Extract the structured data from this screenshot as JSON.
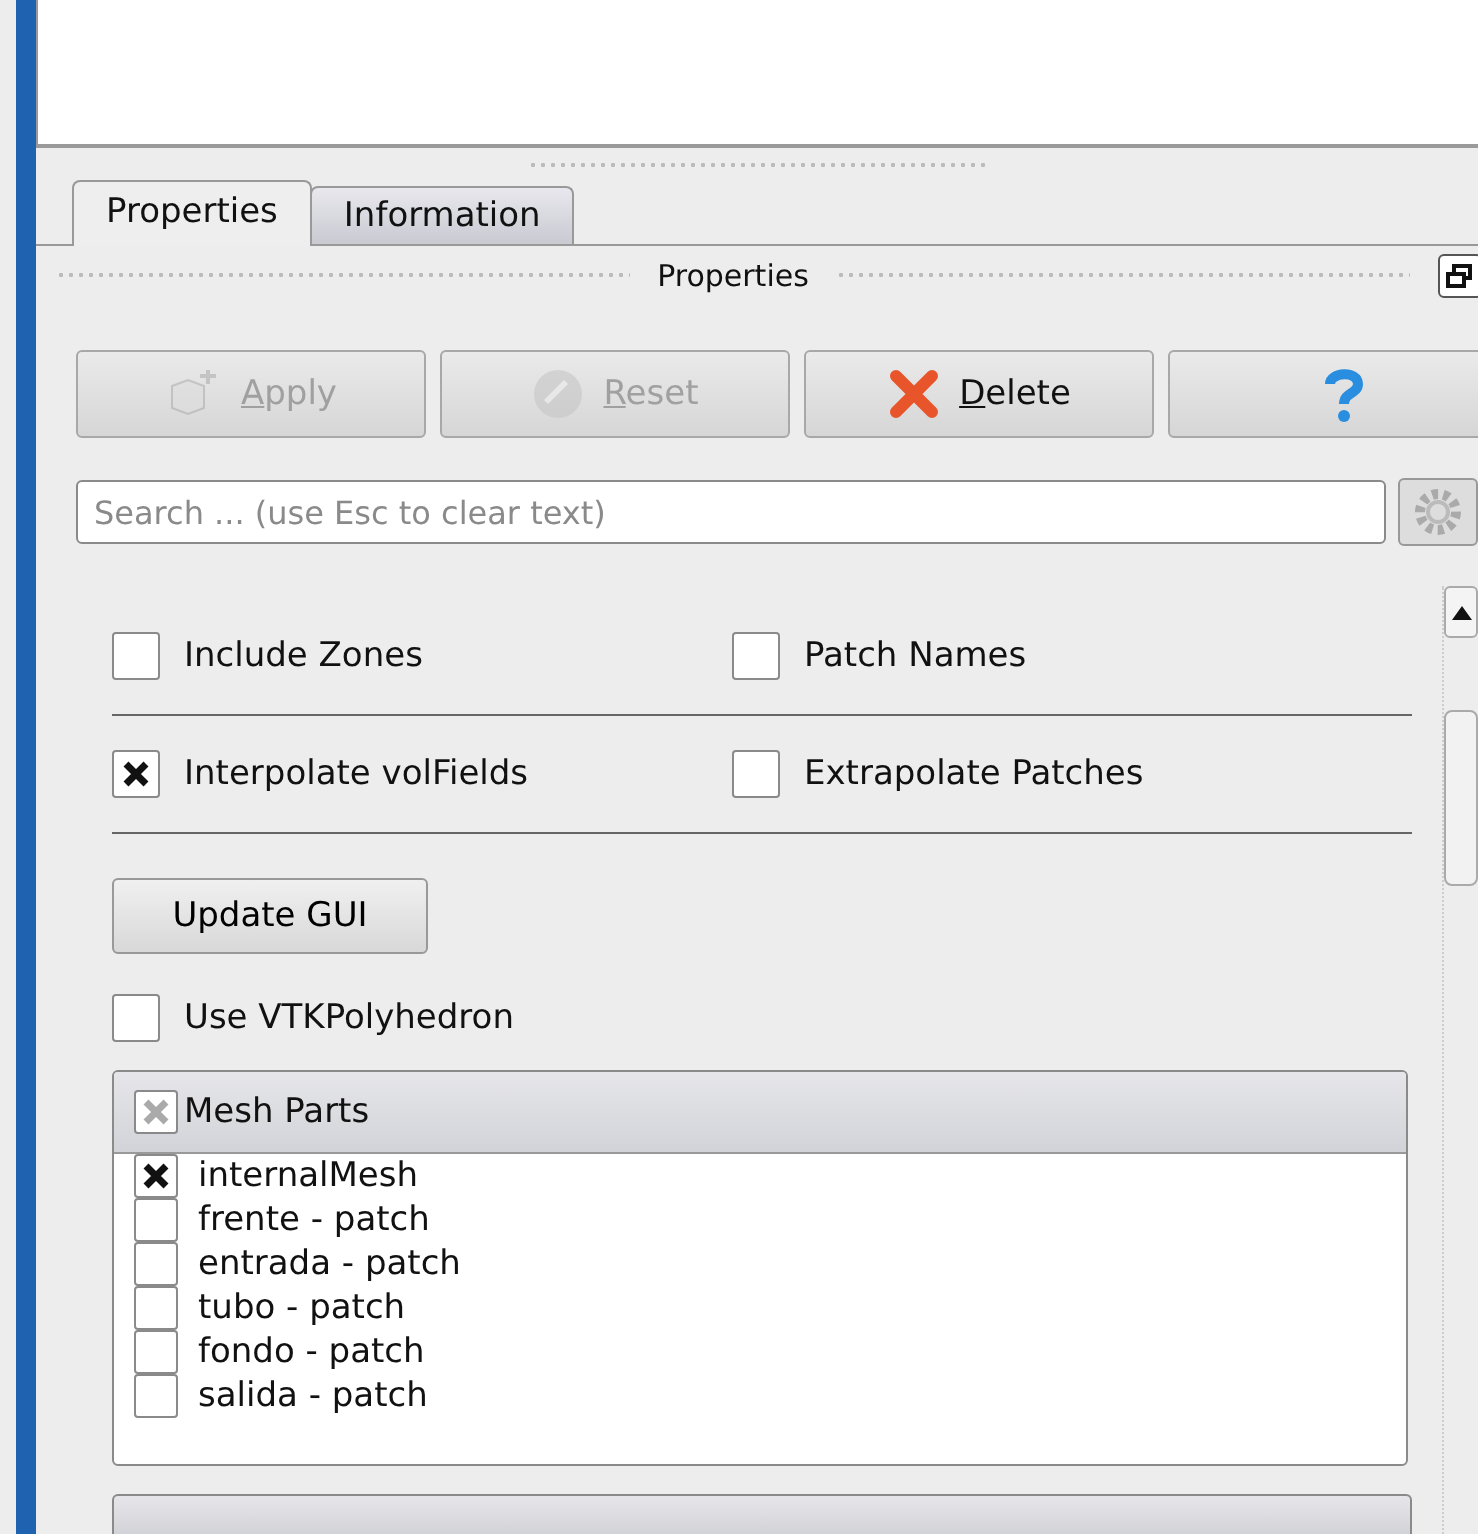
{
  "tabs": [
    {
      "label": "Properties",
      "selected": true
    },
    {
      "label": "Information",
      "selected": false
    }
  ],
  "panel_title": "Properties",
  "buttons": [
    {
      "kind": "apply",
      "label": "Apply",
      "disabled": true
    },
    {
      "kind": "reset",
      "label": "Reset",
      "disabled": true
    },
    {
      "kind": "delete",
      "label": "Delete",
      "disabled": false
    },
    {
      "kind": "help",
      "disabled": false
    }
  ],
  "search": {
    "placeholder": "Search ... (use Esc to clear text)"
  },
  "option_rows": [
    [
      {
        "label": "Include Zones",
        "checked": false
      },
      {
        "label": "Patch Names",
        "checked": false
      }
    ],
    [
      {
        "label": "Interpolate volFields",
        "checked": true
      },
      {
        "label": "Extrapolate Patches",
        "checked": false
      }
    ]
  ],
  "update_button": "Update GUI",
  "polyhedron": {
    "label": "Use VTKPolyhedron",
    "checked": false
  },
  "mesh_parts": {
    "header": "Mesh Parts",
    "select_all": {
      "partial": true
    },
    "items": [
      {
        "label": "internalMesh",
        "checked": true
      },
      {
        "label": "frente - patch",
        "checked": false
      },
      {
        "label": "entrada - patch",
        "checked": false
      },
      {
        "label": "tubo - patch",
        "checked": false
      },
      {
        "label": "fondo - patch",
        "checked": false
      },
      {
        "label": "salida - patch",
        "checked": false
      }
    ]
  }
}
